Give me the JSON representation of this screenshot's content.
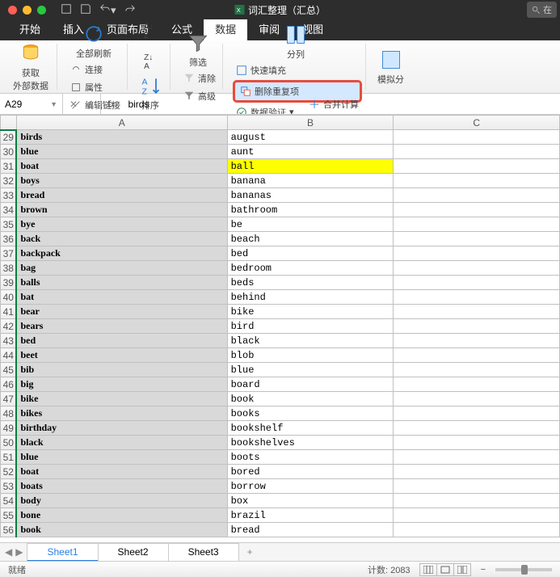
{
  "titlebar": {
    "title": "词汇整理（汇总）",
    "search_placeholder": "在"
  },
  "tabs": {
    "items": [
      "开始",
      "插入",
      "页面布局",
      "公式",
      "数据",
      "审阅",
      "视图"
    ],
    "active_index": 4
  },
  "ribbon": {
    "get_external_data": "获取\n外部数据",
    "refresh_all": "全部刷新",
    "connections": "连接",
    "properties": "属性",
    "edit_links": "编辑链接",
    "sort_asc": "A↓Z",
    "sort_desc": "Z↓A",
    "sort": "排序",
    "filter": "筛选",
    "clear": "清除",
    "advanced": "高级",
    "text_to_columns": "分列",
    "flash_fill": "快速填充",
    "remove_duplicates": "删除重复项",
    "data_validation": "数据验证",
    "consolidate": "合并计算",
    "what_if": "模拟分"
  },
  "formula_bar": {
    "name_box": "A29",
    "fx": "fx",
    "value": "birds"
  },
  "columns": [
    "A",
    "B",
    "C"
  ],
  "rows": [
    {
      "n": 29,
      "a": "birds",
      "b": "august"
    },
    {
      "n": 30,
      "a": "blue",
      "b": "aunt"
    },
    {
      "n": 31,
      "a": "boat",
      "b": "ball",
      "b_hl": true
    },
    {
      "n": 32,
      "a": "boys",
      "b": "banana"
    },
    {
      "n": 33,
      "a": "bread",
      "b": "bananas"
    },
    {
      "n": 34,
      "a": "brown",
      "b": "bathroom"
    },
    {
      "n": 35,
      "a": "bye",
      "b": "be"
    },
    {
      "n": 36,
      "a": "back",
      "b": "beach"
    },
    {
      "n": 37,
      "a": "backpack",
      "b": "bed"
    },
    {
      "n": 38,
      "a": "bag",
      "b": "bedroom"
    },
    {
      "n": 39,
      "a": "balls",
      "b": "beds"
    },
    {
      "n": 40,
      "a": "bat",
      "b": "behind"
    },
    {
      "n": 41,
      "a": "bear",
      "b": "bike"
    },
    {
      "n": 42,
      "a": "bears",
      "b": "bird"
    },
    {
      "n": 43,
      "a": "bed",
      "b": "black"
    },
    {
      "n": 44,
      "a": "beet",
      "b": "blob"
    },
    {
      "n": 45,
      "a": "bib",
      "b": "blue"
    },
    {
      "n": 46,
      "a": "big",
      "b": "board"
    },
    {
      "n": 47,
      "a": "bike",
      "b": "book"
    },
    {
      "n": 48,
      "a": "bikes",
      "b": "books"
    },
    {
      "n": 49,
      "a": "birthday",
      "b": "bookshelf"
    },
    {
      "n": 50,
      "a": "black",
      "b": "bookshelves"
    },
    {
      "n": 51,
      "a": "blue",
      "b": "boots"
    },
    {
      "n": 52,
      "a": "boat",
      "b": "bored"
    },
    {
      "n": 53,
      "a": "boats",
      "b": "borrow"
    },
    {
      "n": 54,
      "a": "body",
      "b": "box"
    },
    {
      "n": 55,
      "a": "bone",
      "b": "brazil"
    },
    {
      "n": 56,
      "a": "book",
      "b": "bread"
    }
  ],
  "sheets": {
    "items": [
      "Sheet1",
      "Sheet2",
      "Sheet3"
    ],
    "active_index": 0
  },
  "status": {
    "ready": "就绪",
    "count_label": "计数:",
    "count": "2083"
  }
}
